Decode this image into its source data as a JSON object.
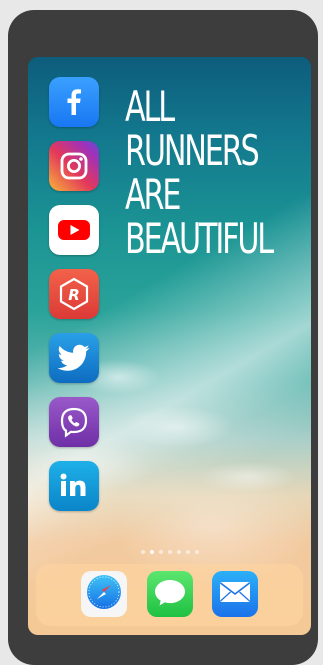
{
  "headline": {
    "lines": [
      "ALL",
      "RUNNERS",
      "ARE",
      "BEAUTIFUL"
    ]
  },
  "apps": [
    {
      "name": "Facebook",
      "icon": "facebook-icon",
      "color": "#1877f2"
    },
    {
      "name": "Instagram",
      "icon": "instagram-icon",
      "color": "#d62976"
    },
    {
      "name": "YouTube",
      "icon": "youtube-icon",
      "color": "#ff0000"
    },
    {
      "name": "Runtastic",
      "icon": "runtastic-icon",
      "color": "#e8443a"
    },
    {
      "name": "Twitter",
      "icon": "twitter-icon",
      "color": "#1da1f2"
    },
    {
      "name": "Viber",
      "icon": "viber-icon",
      "color": "#7d3daf"
    },
    {
      "name": "LinkedIn",
      "icon": "linkedin-icon",
      "color": "#0a8fd6"
    }
  ],
  "dock": [
    {
      "name": "Safari",
      "icon": "safari-icon"
    },
    {
      "name": "Messages",
      "icon": "messages-icon",
      "color": "#2fd05a"
    },
    {
      "name": "Mail",
      "icon": "mail-icon",
      "color": "#1a8cf0"
    }
  ],
  "page_indicator": {
    "pages": 7,
    "current": 2
  }
}
